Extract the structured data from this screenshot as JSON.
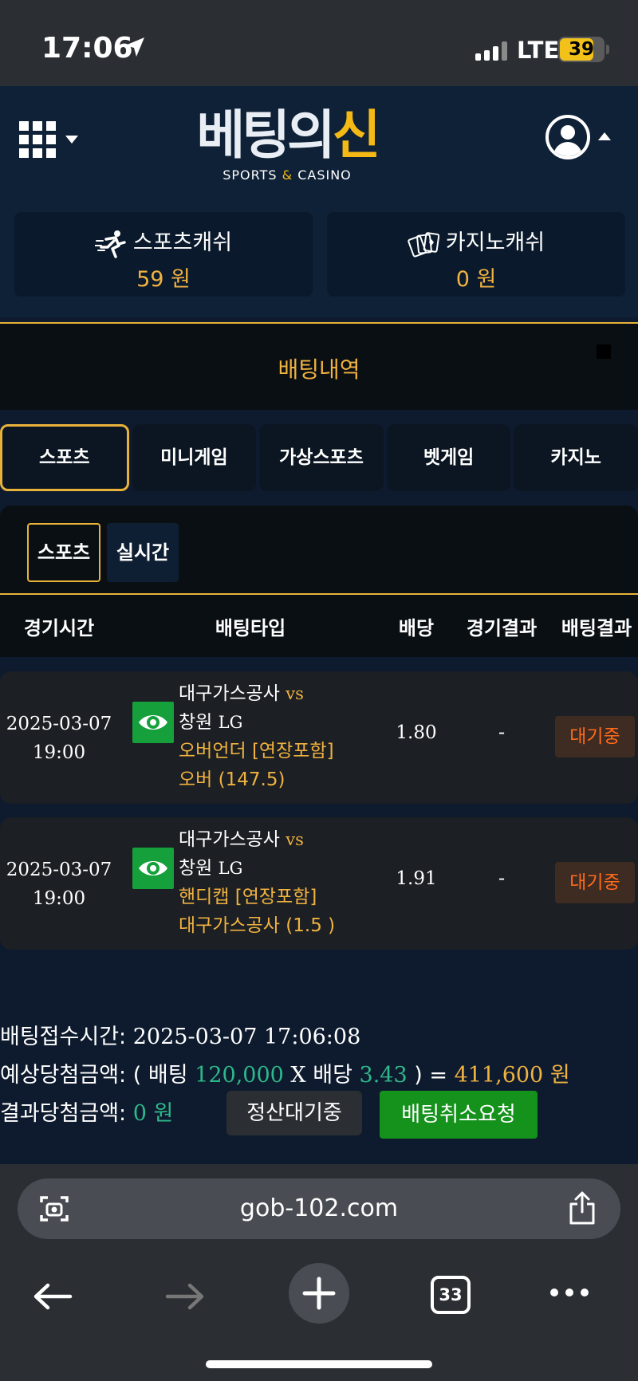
{
  "status_bar": {
    "time": "17:06",
    "network": "LTE",
    "battery": "39"
  },
  "header": {
    "logo_main_a": "베팅의",
    "logo_main_b": "신",
    "logo_sub_a": "SPORTS ",
    "logo_sub_amp": "&",
    "logo_sub_b": " CASINO",
    "sports_cash_label": "스포츠캐쉬",
    "sports_cash_value": "59 원",
    "casino_cash_label": "카지노캐쉬",
    "casino_cash_value": "0 원"
  },
  "section": {
    "title": "배팅내역"
  },
  "tabs": [
    "스포츠",
    "미니게임",
    "가상스포츠",
    "벳게임",
    "카지노"
  ],
  "subtabs": [
    "스포츠",
    "실시간"
  ],
  "columns": [
    "경기시간",
    "배팅타입",
    "배당",
    "경기결과",
    "배팅결과"
  ],
  "bets": [
    {
      "date": "2025-03-07",
      "time": "19:00",
      "home": "대구가스공사",
      "vs": "vs",
      "away_a": "창원",
      "away_b": "LG",
      "market": "오버언더 [연장포함]",
      "pick": "오버 (147.5)",
      "odds": "1.80",
      "result": "-",
      "status": "대기중"
    },
    {
      "date": "2025-03-07",
      "time": "19:00",
      "home": "대구가스공사",
      "vs": "vs",
      "away_a": "창원",
      "away_b": "LG",
      "market": "핸디캡 [연장포함]",
      "pick": "대구가스공사 (1.5 )",
      "odds": "1.91",
      "result": "-",
      "status": "대기중"
    }
  ],
  "summary": {
    "time_label": "배팅접수시간:",
    "time_value": "2025-03-07 17:06:08",
    "expected_label": "예상당첨금액:",
    "expected_open": "(",
    "bet_word": "배팅",
    "bet_amount": "120,000",
    "x": "X",
    "odds_word": "배당",
    "odds_total": "3.43",
    "expected_close": ") =",
    "expected_value": "411,600 원",
    "result_label": "결과당첨금액:",
    "result_value": "0 원",
    "pending_button": "정산대기중",
    "cancel_button": "배팅취소요청"
  },
  "browser": {
    "url": "gob-102.com",
    "tab_count": "33"
  },
  "colors": {
    "accent": "#f0b240",
    "green": "#2db88a",
    "status": "#ff6a1a",
    "cancel": "#14921c"
  }
}
